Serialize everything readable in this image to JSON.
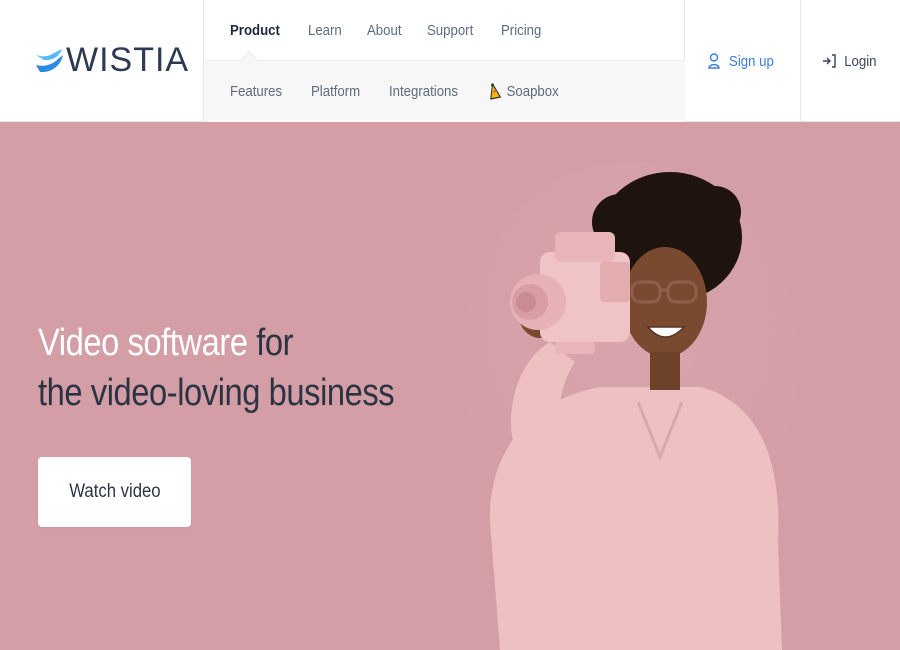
{
  "brand": {
    "name": "WISTIA"
  },
  "nav": {
    "primary": [
      "Product",
      "Learn",
      "About",
      "Support",
      "Pricing"
    ],
    "active": "Product",
    "secondary": [
      "Features",
      "Platform",
      "Integrations",
      "Soapbox"
    ]
  },
  "auth": {
    "signup": "Sign up",
    "login": "Login"
  },
  "hero": {
    "headline_highlight": "Video software",
    "headline_rest1": " for",
    "headline_line2": "the video-loving business",
    "cta": "Watch video"
  },
  "colors": {
    "hero_bg": "#d39ea6",
    "brand_blue": "#3b7dd8",
    "text_dark": "#2c3444"
  },
  "icons": {
    "logo": "wistia-logo-icon",
    "soapbox": "soapbox-icon",
    "signup": "user-icon",
    "login": "login-arrow-icon"
  }
}
